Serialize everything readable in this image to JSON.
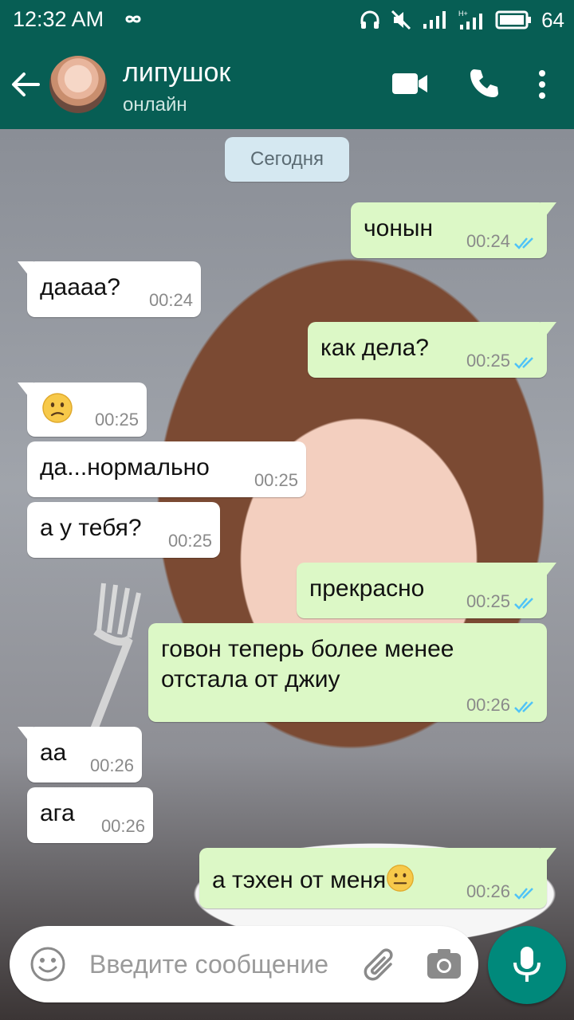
{
  "status_bar": {
    "time": "12:32 AM",
    "battery": "64"
  },
  "header": {
    "contact_name": "липушок",
    "status": "онлайн"
  },
  "chat": {
    "date_label": "Сегодня",
    "messages": [
      {
        "dir": "out",
        "text": "чонын",
        "time": "00:24"
      },
      {
        "dir": "in",
        "text": "даааа?",
        "time": "00:24"
      },
      {
        "dir": "out",
        "text": "как дела?",
        "time": "00:25"
      },
      {
        "dir": "in",
        "text": "",
        "emoji": "confused-face",
        "time": "00:25"
      },
      {
        "dir": "in",
        "text": "да...нормально",
        "time": "00:25"
      },
      {
        "dir": "in",
        "text": "а у тебя?",
        "time": "00:25"
      },
      {
        "dir": "out",
        "text": "прекрасно",
        "time": "00:25"
      },
      {
        "dir": "out",
        "text_line1": "говон теперь более менее",
        "text_line2": "отстала от джиу",
        "time": "00:26"
      },
      {
        "dir": "in",
        "text": "аа",
        "time": "00:26"
      },
      {
        "dir": "in",
        "text": "ага",
        "time": "00:26"
      },
      {
        "dir": "out",
        "text": "а тэхен от меня",
        "emoji": "neutral-face",
        "time": "00:26"
      }
    ]
  },
  "input": {
    "placeholder": "Введите сообщение"
  },
  "colors": {
    "header": "#075e54",
    "outgoing": "#dcf8c6",
    "incoming": "#ffffff",
    "mic": "#00897b",
    "ticks": "#4fc3f7"
  }
}
